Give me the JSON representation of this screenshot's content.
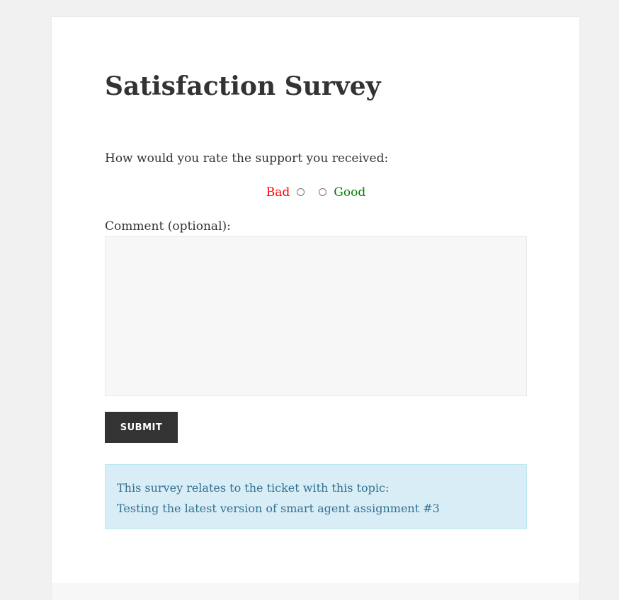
{
  "survey": {
    "title": "Satisfaction Survey",
    "question": "How would you rate the support you received:",
    "rating": {
      "bad_label": "Bad",
      "good_label": "Good",
      "bad_color": "#ff0000",
      "good_color": "#008000"
    },
    "comment_label": "Comment (optional):",
    "comment_value": "",
    "submit_label": "SUBMIT"
  },
  "ticket_info": {
    "line1": "This survey relates to the ticket with this topic:",
    "line2": "Testing the latest version of smart agent assignment #3"
  },
  "colors": {
    "page_background": "#f1f1f1",
    "card_background": "#ffffff",
    "button_background": "#333333",
    "info_background": "#d9edf7",
    "info_text": "#31708f"
  }
}
